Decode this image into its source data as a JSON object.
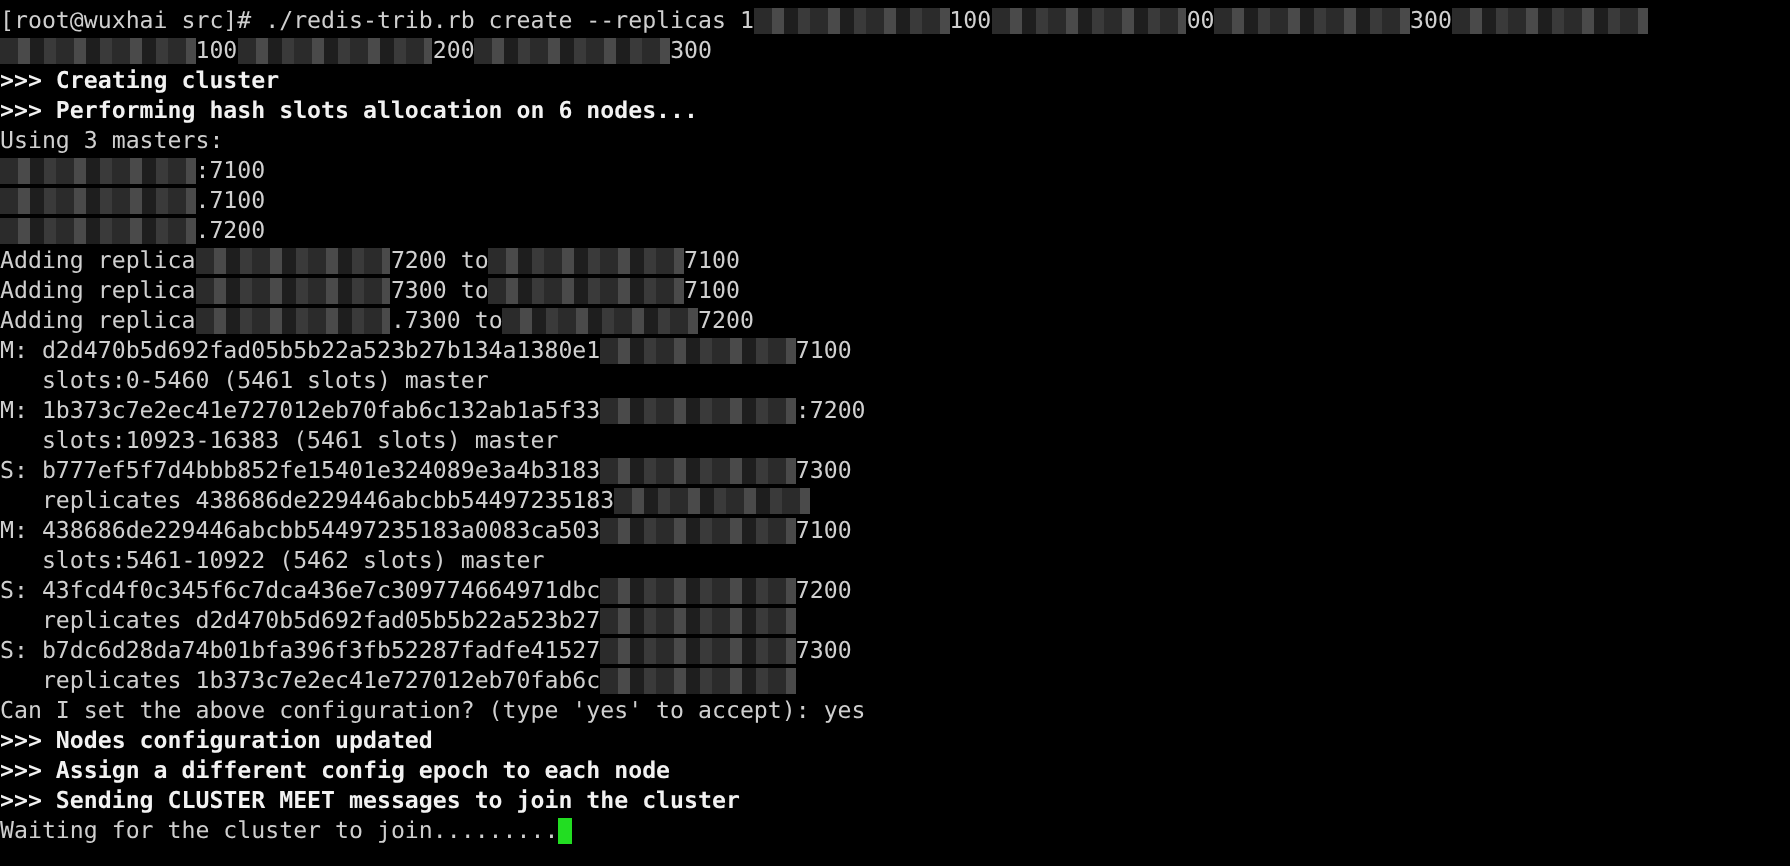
{
  "terminal": {
    "lines": [
      {
        "bold": false,
        "segments": [
          {
            "kind": "text",
            "text": "[root@wuxhai src]# ./redis-trib.rb create --replicas 1"
          },
          {
            "kind": "redacted"
          },
          {
            "kind": "text",
            "text": "100"
          },
          {
            "kind": "redacted"
          },
          {
            "kind": "text",
            "text": "00"
          },
          {
            "kind": "redacted"
          },
          {
            "kind": "text",
            "text": "300"
          },
          {
            "kind": "redacted"
          }
        ]
      },
      {
        "bold": false,
        "segments": [
          {
            "kind": "redacted"
          },
          {
            "kind": "text",
            "text": "100"
          },
          {
            "kind": "redacted"
          },
          {
            "kind": "text",
            "text": "200"
          },
          {
            "kind": "redacted"
          },
          {
            "kind": "text",
            "text": "300"
          }
        ]
      },
      {
        "bold": true,
        "segments": [
          {
            "kind": "text",
            "text": ">>> Creating cluster"
          }
        ]
      },
      {
        "bold": true,
        "segments": [
          {
            "kind": "text",
            "text": ">>> Performing hash slots allocation on 6 nodes..."
          }
        ]
      },
      {
        "bold": false,
        "segments": [
          {
            "kind": "text",
            "text": "Using 3 masters:"
          }
        ]
      },
      {
        "bold": false,
        "segments": [
          {
            "kind": "redacted"
          },
          {
            "kind": "text",
            "text": ":7100"
          }
        ]
      },
      {
        "bold": false,
        "segments": [
          {
            "kind": "redacted"
          },
          {
            "kind": "text",
            "text": ".7100"
          }
        ]
      },
      {
        "bold": false,
        "segments": [
          {
            "kind": "redacted"
          },
          {
            "kind": "text",
            "text": ".7200"
          }
        ]
      },
      {
        "bold": false,
        "segments": [
          {
            "kind": "text",
            "text": "Adding replica"
          },
          {
            "kind": "redacted"
          },
          {
            "kind": "text",
            "text": "7200 to"
          },
          {
            "kind": "redacted"
          },
          {
            "kind": "text",
            "text": "7100"
          }
        ]
      },
      {
        "bold": false,
        "segments": [
          {
            "kind": "text",
            "text": "Adding replica"
          },
          {
            "kind": "redacted"
          },
          {
            "kind": "text",
            "text": "7300 to"
          },
          {
            "kind": "redacted"
          },
          {
            "kind": "text",
            "text": "7100"
          }
        ]
      },
      {
        "bold": false,
        "segments": [
          {
            "kind": "text",
            "text": "Adding replica"
          },
          {
            "kind": "redacted"
          },
          {
            "kind": "text",
            "text": ".7300 to"
          },
          {
            "kind": "redacted"
          },
          {
            "kind": "text",
            "text": "7200"
          }
        ]
      },
      {
        "bold": false,
        "segments": [
          {
            "kind": "text",
            "text": "M: d2d470b5d692fad05b5b22a523b27b134a1380e1"
          },
          {
            "kind": "redacted"
          },
          {
            "kind": "text",
            "text": "7100"
          }
        ]
      },
      {
        "bold": false,
        "segments": [
          {
            "kind": "text",
            "text": "   slots:0-5460 (5461 slots) master"
          }
        ]
      },
      {
        "bold": false,
        "segments": [
          {
            "kind": "text",
            "text": "M: 1b373c7e2ec41e727012eb70fab6c132ab1a5f33"
          },
          {
            "kind": "redacted"
          },
          {
            "kind": "text",
            "text": ":7200"
          }
        ]
      },
      {
        "bold": false,
        "segments": [
          {
            "kind": "text",
            "text": "   slots:10923-16383 (5461 slots) master"
          }
        ]
      },
      {
        "bold": false,
        "segments": [
          {
            "kind": "text",
            "text": "S: b777ef5f7d4bbb852fe15401e324089e3a4b3183"
          },
          {
            "kind": "redacted"
          },
          {
            "kind": "text",
            "text": "7300"
          }
        ]
      },
      {
        "bold": false,
        "segments": [
          {
            "kind": "text",
            "text": "   replicates 438686de229446abcbb54497235183"
          },
          {
            "kind": "redacted"
          }
        ]
      },
      {
        "bold": false,
        "segments": [
          {
            "kind": "text",
            "text": "M: 438686de229446abcbb54497235183a0083ca503"
          },
          {
            "kind": "redacted"
          },
          {
            "kind": "text",
            "text": "7100"
          }
        ]
      },
      {
        "bold": false,
        "segments": [
          {
            "kind": "text",
            "text": "   slots:5461-10922 (5462 slots) master"
          }
        ]
      },
      {
        "bold": false,
        "segments": [
          {
            "kind": "text",
            "text": "S: 43fcd4f0c345f6c7dca436e7c309774664971dbc"
          },
          {
            "kind": "redacted"
          },
          {
            "kind": "text",
            "text": "7200"
          }
        ]
      },
      {
        "bold": false,
        "segments": [
          {
            "kind": "text",
            "text": "   replicates d2d470b5d692fad05b5b22a523b27"
          },
          {
            "kind": "redacted"
          }
        ]
      },
      {
        "bold": false,
        "segments": [
          {
            "kind": "text",
            "text": "S: b7dc6d28da74b01bfa396f3fb52287fadfe41527"
          },
          {
            "kind": "redacted"
          },
          {
            "kind": "text",
            "text": "7300"
          }
        ]
      },
      {
        "bold": false,
        "segments": [
          {
            "kind": "text",
            "text": "   replicates 1b373c7e2ec41e727012eb70fab6c"
          },
          {
            "kind": "redacted"
          }
        ]
      },
      {
        "bold": false,
        "segments": [
          {
            "kind": "text",
            "text": "Can I set the above configuration? (type 'yes' to accept): yes"
          }
        ]
      },
      {
        "bold": true,
        "segments": [
          {
            "kind": "text",
            "text": ">>> Nodes configuration updated"
          }
        ]
      },
      {
        "bold": true,
        "segments": [
          {
            "kind": "text",
            "text": ">>> Assign a different config epoch to each node"
          }
        ]
      },
      {
        "bold": true,
        "segments": [
          {
            "kind": "text",
            "text": ">>> Sending CLUSTER MEET messages to join the cluster"
          }
        ]
      },
      {
        "bold": false,
        "cursor": true,
        "segments": [
          {
            "kind": "text",
            "text": "Waiting for the cluster to join........."
          }
        ]
      }
    ]
  }
}
